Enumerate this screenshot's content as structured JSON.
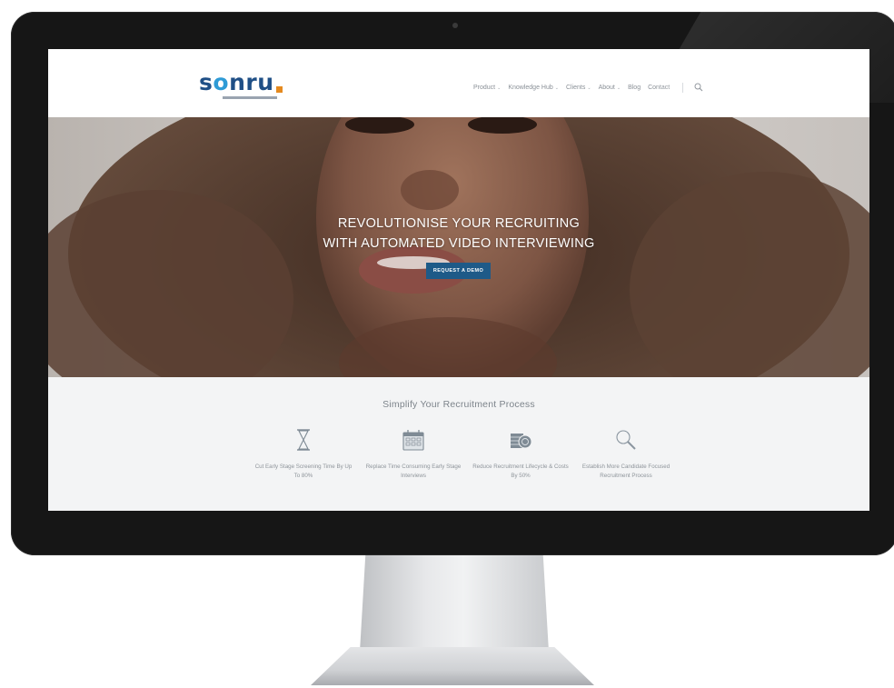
{
  "logo": {
    "text_pre": "s",
    "text_ring": "o",
    "text_post": "nru",
    "brand_color": "#1f4f86",
    "accent_color": "#e58a1f"
  },
  "nav": {
    "items": [
      {
        "label": "Product",
        "has_dropdown": true
      },
      {
        "label": "Knowledge Hub",
        "has_dropdown": true
      },
      {
        "label": "Clients",
        "has_dropdown": true
      },
      {
        "label": "About",
        "has_dropdown": true
      },
      {
        "label": "Blog",
        "has_dropdown": false
      },
      {
        "label": "Contact",
        "has_dropdown": false
      }
    ],
    "caret": "⌄",
    "search_icon": "search-icon"
  },
  "hero": {
    "title_line1": "REVOLUTIONISE YOUR RECRUITING",
    "title_line2": "WITH AUTOMATED VIDEO INTERVIEWING",
    "cta_label": "REQUEST A DEMO",
    "cta_color": "#1e5a88"
  },
  "features": {
    "title": "Simplify Your Recruitment Process",
    "items": [
      {
        "icon": "hourglass-icon",
        "text": "Cut Early Stage Screening Time By Up To 80%"
      },
      {
        "icon": "calendar-icon",
        "text": "Replace Time Consuming Early Stage Interviews"
      },
      {
        "icon": "coins-icon",
        "text": "Reduce Recruitment Lifecycle & Costs By 50%"
      },
      {
        "icon": "magnifier-icon",
        "text": "Establish More Candidate Focused Recruitment Process"
      }
    ]
  }
}
